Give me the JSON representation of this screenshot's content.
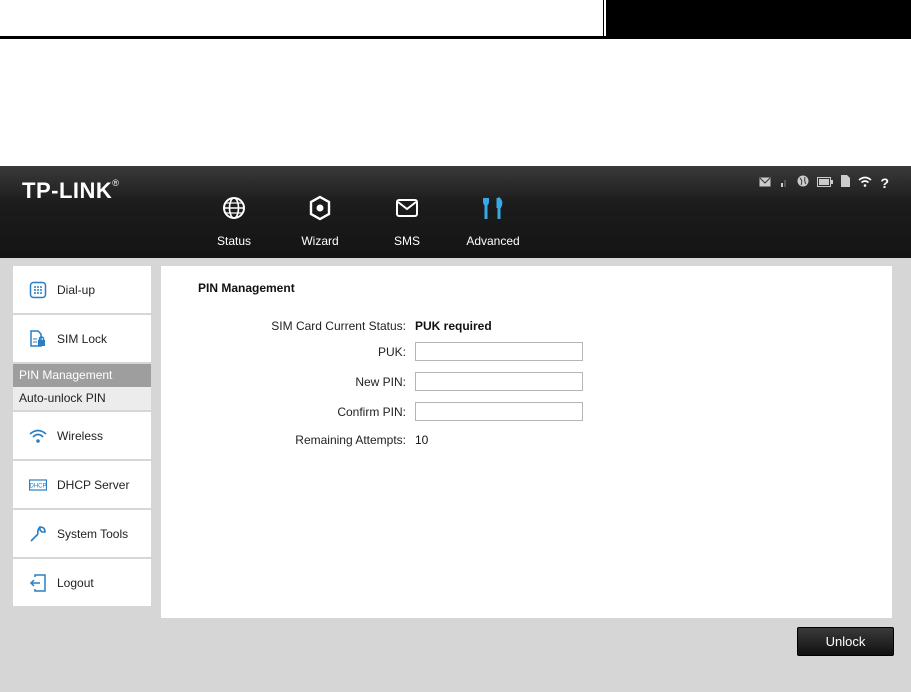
{
  "brand": {
    "logo_text": "TP-LINK",
    "logo_mark": "®"
  },
  "nav": {
    "items": [
      {
        "label": "Status",
        "icon": "globe-icon"
      },
      {
        "label": "Wizard",
        "icon": "wizard-icon"
      },
      {
        "label": "SMS",
        "icon": "envelope-icon"
      },
      {
        "label": "Advanced",
        "icon": "tools-icon",
        "active": true
      }
    ]
  },
  "status_icons": [
    "sms-icon",
    "signal-icon",
    "internet-icon",
    "battery-icon",
    "sim-icon",
    "wifi-icon",
    "help-icon"
  ],
  "sidebar": {
    "items": [
      {
        "label": "Dial-up",
        "icon": "dialpad-icon"
      },
      {
        "label": "SIM Lock",
        "icon": "sim-lock-icon"
      },
      {
        "label": "Wireless",
        "icon": "wifi-icon"
      },
      {
        "label": "DHCP Server",
        "icon": "dhcp-icon"
      },
      {
        "label": "System Tools",
        "icon": "wrench-icon"
      },
      {
        "label": "Logout",
        "icon": "logout-icon"
      }
    ],
    "sim_lock_sub": [
      {
        "label": "PIN Management",
        "active": true
      },
      {
        "label": "Auto-unlock PIN",
        "active": false
      }
    ]
  },
  "main": {
    "title": "PIN Management",
    "sim_status_label": "SIM Card Current Status:",
    "sim_status_value": "PUK required",
    "puk_label": "PUK:",
    "puk_value": "",
    "new_pin_label": "New PIN:",
    "new_pin_value": "",
    "confirm_pin_label": "Confirm PIN:",
    "confirm_pin_value": "",
    "remaining_label": "Remaining Attempts:",
    "remaining_value": "10"
  },
  "actions": {
    "unlock_label": "Unlock"
  },
  "colors": {
    "topbar": "#1c1c1c",
    "active_accent": "#39a9e6",
    "sidebar_active": "#9e9e9e",
    "page_bg": "#d6d6d6"
  }
}
